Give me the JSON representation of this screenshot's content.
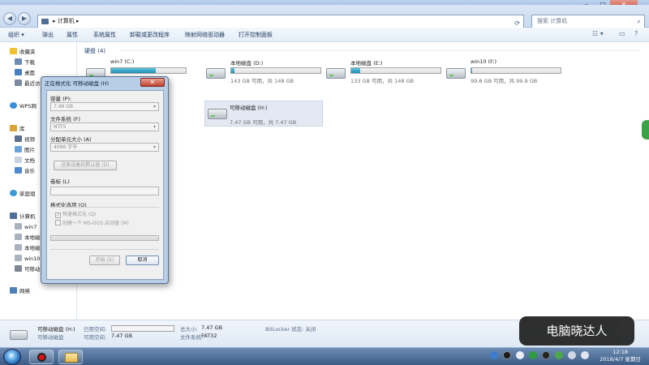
{
  "address": {
    "path": "▸ 计算机 ▸",
    "search_placeholder": "搜索 计算机"
  },
  "toolbar": {
    "items": [
      "组织 ▾",
      "弹出",
      "属性",
      "系统属性",
      "卸载或更改程序",
      "映射网络驱动器",
      "打开控制面板"
    ]
  },
  "sidebar": {
    "favorites": "收藏夹",
    "downloads": "下载",
    "desktop": "桌面",
    "recent": "最近访",
    "wps": "WPS网",
    "libraries": "库",
    "videos": "视频",
    "pictures": "图片",
    "documents": "文档",
    "music": "音乐",
    "homegroup": "家庭组",
    "computer": "计算机",
    "win7": "win7",
    "local1": "本地磁",
    "local2": "本地磁",
    "win10": "win10",
    "removable": "可移动",
    "network": "网络"
  },
  "content": {
    "group_title": "硬盘 (4)",
    "drives": [
      {
        "name": "win7 (C:)",
        "info": "",
        "fill": 0.6
      },
      {
        "name": "本地磁盘 (D:)",
        "info": "143 GB 可用，共 148 GB",
        "fill": 0.04
      },
      {
        "name": "本地磁盘 (E:)",
        "info": "133 GB 可用，共 148 GB",
        "fill": 0.1
      },
      {
        "name": "win10 (F:)",
        "info": "99.8 GB 可用，共 99.9 GB",
        "fill": 0.01
      }
    ],
    "removable": {
      "name": "可移动磁盘 (H:)",
      "info": "7.47 GB 可用，共 7.47 GB",
      "fill": 0.0
    }
  },
  "details": {
    "name": "可移动磁盘 (H:)",
    "type": "可移动磁盘",
    "used_label": "已用空间:",
    "free_label": "可用空间:",
    "free_value": "7.47 GB",
    "total_label": "总大小:",
    "total_value": "7.47 GB",
    "fs_label": "文件系统:",
    "fs_value": "FAT32",
    "bitlocker": "BitLocker 状态: 关闭"
  },
  "dialog": {
    "title": "正在格式化 可移动磁盘 (H)",
    "close": "✕",
    "capacity_label": "容量 (P):",
    "capacity_value": "7.49 GB",
    "fs_label": "文件系统 (F)",
    "fs_value": "NTFS",
    "alloc_label": "分配单元大小 (A)",
    "alloc_value": "4096 字节",
    "restore_btn": "还原设备的默认值 (D)",
    "volume_label": "卷标 (L)",
    "format_options": "格式化选项 (O)",
    "quick_format": "快速格式化 (Q)",
    "msdos": "创建一个 MS-DOS 启动盘 (M)",
    "start_btn": "开始 (S)",
    "cancel_btn": "取消",
    "progress": 0.0
  },
  "taskbar": {
    "time": "12:18",
    "date": "2018/4/7 星期日"
  },
  "watermark": "电脑晓达人",
  "colors": {
    "accent": "#1d8fb3",
    "taskbar": "#3c5c86",
    "close": "#c4412e"
  }
}
